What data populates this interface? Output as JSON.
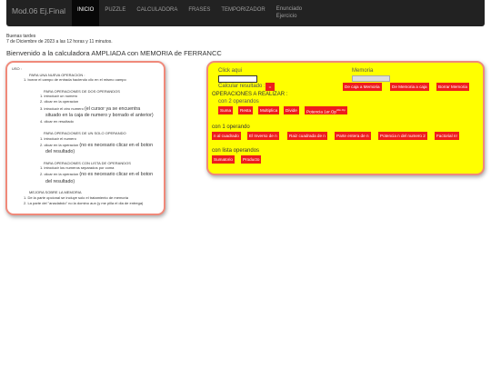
{
  "navbar": {
    "brand": "Mod.06 Ej.Final",
    "items": [
      {
        "label": "INICIO",
        "active": true
      },
      {
        "label": "PUZZLE"
      },
      {
        "label": "CALCULADORA"
      },
      {
        "label": "FRASES"
      },
      {
        "label": "TEMPORIZADOR"
      },
      {
        "label_line1": "Enunciado",
        "label_line2": "Ejercicio"
      }
    ]
  },
  "greeting": {
    "line1": "Buenas tardes",
    "line2": "7 de Diciembre de 2023 a las 12 horas y 11 minutos."
  },
  "welcome": "Bienvenido a la calculadora AMPLIADA con MEMORIA de FERRANCC",
  "usage": {
    "title": "USO :",
    "new_op": "PARA UNA NUEVA OPERACION :",
    "new_op_step": "1. borrar el campo de entrada haciendo clic en el mismo campo",
    "two_title": "PARA OPERACIONES DE DOS OPERANDOS",
    "two_1": "1. introducir un numero",
    "two_2": "2. clicar en la operacion",
    "two_3_small": "3. introducir el otro numero",
    "two_3_big_a": "(el cursor ya se encuentra",
    "two_3_big_b": "situado en la caja de numero y borrado el anterior)",
    "two_4": "4. clicar en resultado",
    "one_title": "PARA OPERACIONES DE UN SOLO OPERANDO",
    "one_1": "1. introducir el numero",
    "one_2_small": "2. clicar en la operacion",
    "one_2_big_a": "(no es necesario clicar en el boton",
    "one_2_big_b": "del resultado)",
    "list_title": "PARA OPERACIONES CON LISTA DE OPERANDOS",
    "list_1": "1. introducir los numeros separados por coma",
    "list_2_small": "2. clicar en la operacion",
    "list_2_big_a": "(no es necesario clicar en el boton",
    "list_2_big_b": "del resultado)",
    "improve_title": "MEJORA SOBRE LA MEMORIA",
    "improve_1": "1. De la parte opcional se incluye solo el tratamiento de memoria",
    "improve_2": "2. La parte del \"anaclabdo\" no la domino aun (y me pilla el dia de entrega)"
  },
  "calc": {
    "click_here": "Click aqui",
    "calc_result": "Calcular resultado :",
    "equals_btn": "=",
    "memory_label": "Memoria",
    "mem_buttons": [
      "De caja a Memoria",
      "De Memoria a caja",
      "Borrar Memoria"
    ],
    "ops_title": "OPERACIONES A REALIZAR :",
    "two_ops_title": "con 2 operandos",
    "two_ops": [
      "Suma",
      "Resta",
      "Multiplica",
      "Divide"
    ],
    "power_base": "Potencia 1er.Op",
    "power_sup": "2do.Op",
    "one_op_title": "con 1 operando",
    "one_ops": [
      "n al cuadrado",
      "El Inverso de n",
      "Raiz cuadrada de n",
      "Parte entera de n",
      "Potencia n del numero 2",
      "Factorial n!"
    ],
    "list_op_title": "con lista operandos",
    "list_ops": [
      "Sumatorio",
      "Producto"
    ]
  }
}
